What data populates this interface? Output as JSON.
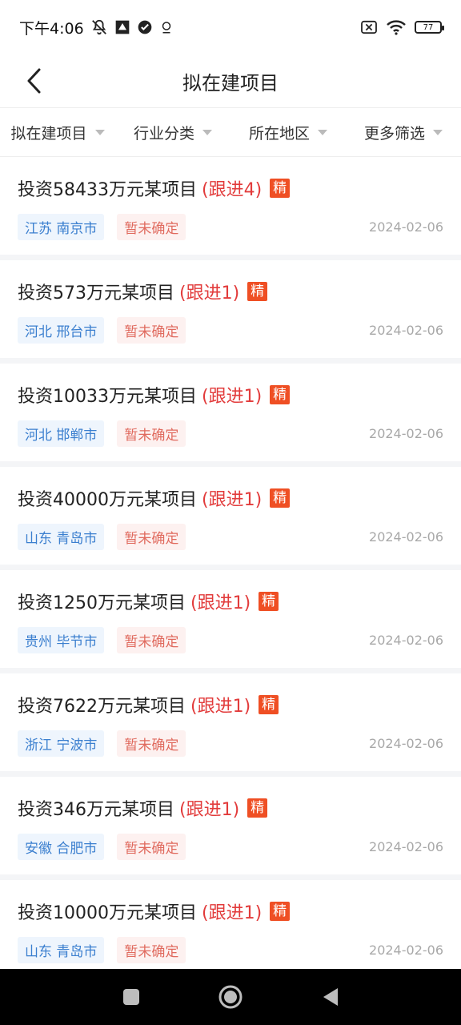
{
  "status_bar": {
    "time": "下午4:06",
    "battery_level": "77",
    "icons": [
      "mute-icon",
      "app-icon",
      "check-circle-icon",
      "location-icon",
      "sim-off-icon",
      "wifi-icon",
      "battery-icon"
    ]
  },
  "nav": {
    "title": "拟在建项目",
    "back_icon": "chevron-left-icon"
  },
  "filters": [
    {
      "label": "拟在建项目"
    },
    {
      "label": "行业分类"
    },
    {
      "label": "所在地区"
    },
    {
      "label": "更多筛选"
    }
  ],
  "items": [
    {
      "title": "投资58433万元某项目",
      "follow": "(跟进4)",
      "badge": "精",
      "region": "江苏 南京市",
      "status": "暂未确定",
      "date": "2024-02-06"
    },
    {
      "title": "投资573万元某项目",
      "follow": "(跟进1)",
      "badge": "精",
      "region": "河北 邢台市",
      "status": "暂未确定",
      "date": "2024-02-06"
    },
    {
      "title": "投资10033万元某项目",
      "follow": "(跟进1)",
      "badge": "精",
      "region": "河北 邯郸市",
      "status": "暂未确定",
      "date": "2024-02-06"
    },
    {
      "title": "投资40000万元某项目",
      "follow": "(跟进1)",
      "badge": "精",
      "region": "山东 青岛市",
      "status": "暂未确定",
      "date": "2024-02-06"
    },
    {
      "title": "投资1250万元某项目",
      "follow": "(跟进1)",
      "badge": "精",
      "region": "贵州 毕节市",
      "status": "暂未确定",
      "date": "2024-02-06"
    },
    {
      "title": "投资7622万元某项目",
      "follow": "(跟进1)",
      "badge": "精",
      "region": "浙江 宁波市",
      "status": "暂未确定",
      "date": "2024-02-06"
    },
    {
      "title": "投资346万元某项目",
      "follow": "(跟进1)",
      "badge": "精",
      "region": "安徽 合肥市",
      "status": "暂未确定",
      "date": "2024-02-06"
    },
    {
      "title": "投资10000万元某项目",
      "follow": "(跟进1)",
      "badge": "精",
      "region": "山东 青岛市",
      "status": "暂未确定",
      "date": "2024-02-06"
    }
  ],
  "colors": {
    "accent_red": "#e23b3b",
    "badge_orange": "#ef4f24",
    "region_blue": "#3b7fcf",
    "status_red": "#e06a5e"
  },
  "system_nav": [
    "recents-icon",
    "home-icon",
    "back-icon"
  ]
}
